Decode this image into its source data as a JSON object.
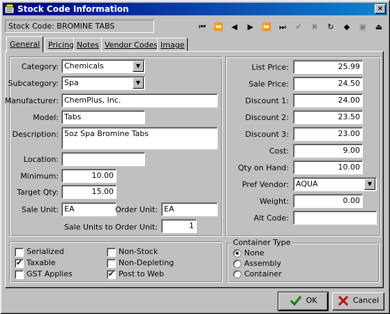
{
  "window": {
    "title": "Stock Code Information",
    "title_icon": "app-icon",
    "close_glyph": "×"
  },
  "header": {
    "stock_code": "Stock Code: BROMINE TABS"
  },
  "nav": {
    "buttons": [
      {
        "name": "first-record",
        "glyph": "⏮",
        "enabled": true
      },
      {
        "name": "prev-page",
        "glyph": "⏪",
        "enabled": true
      },
      {
        "name": "prev-record",
        "glyph": "◀",
        "enabled": true
      },
      {
        "name": "next-record",
        "glyph": "▶",
        "enabled": true
      },
      {
        "name": "next-page",
        "glyph": "⏩",
        "enabled": true
      },
      {
        "name": "last-record",
        "glyph": "⏭",
        "enabled": true
      },
      {
        "name": "confirm",
        "glyph": "✔",
        "enabled": false
      },
      {
        "name": "cancel-edit",
        "glyph": "✖",
        "enabled": false
      },
      {
        "name": "refresh",
        "glyph": "↻",
        "enabled": true
      },
      {
        "name": "tag",
        "glyph": "◆",
        "enabled": true
      },
      {
        "name": "note",
        "glyph": "▣",
        "enabled": false
      },
      {
        "name": "exit",
        "glyph": "⏏",
        "enabled": true
      }
    ]
  },
  "tabs": [
    {
      "label": "General",
      "active": true
    },
    {
      "label": "Pricing"
    },
    {
      "label": "Notes"
    },
    {
      "label": "Vendor Codes"
    },
    {
      "label": "Image"
    }
  ],
  "left": {
    "category": {
      "label": "Category:",
      "value": "Chemicals"
    },
    "subcategory": {
      "label": "Subcategory:",
      "value": "Spa"
    },
    "manufacturer": {
      "label": "Manufacturer:",
      "value": "ChemPlus, Inc."
    },
    "model": {
      "label": "Model:",
      "value": "Tabs"
    },
    "description": {
      "label": "Description:",
      "value": "5oz Spa Bromine Tabs"
    },
    "location": {
      "label": "Location:",
      "value": ""
    },
    "minimum": {
      "label": "Minimum:",
      "value": "10.00"
    },
    "target_qty": {
      "label": "Target Qty:",
      "value": "15.00"
    },
    "sale_unit": {
      "label": "Sale Unit:",
      "value": "EA"
    },
    "order_unit": {
      "label": "Order Unit:",
      "value": "EA"
    },
    "sale_to_order": {
      "label": "Sale Units to Order Unit:",
      "value": "1"
    }
  },
  "right": {
    "list_price": {
      "label": "List Price:",
      "value": "25.99"
    },
    "sale_price": {
      "label": "Sale Price:",
      "value": "24.50"
    },
    "discount1": {
      "label": "Discount 1:",
      "value": "24.00"
    },
    "discount2": {
      "label": "Discount 2:",
      "value": "23.50"
    },
    "discount3": {
      "label": "Discount 3:",
      "value": "23.00"
    },
    "cost": {
      "label": "Cost:",
      "value": "9.00"
    },
    "qty_on_hand": {
      "label": "Qty on Hand:",
      "value": "10.00"
    },
    "pref_vendor": {
      "label": "Pref Vendor:",
      "value": "AQUA"
    },
    "weight": {
      "label": "Weight:",
      "value": "0.00"
    },
    "alt_code": {
      "label": "Alt Code:",
      "value": ""
    }
  },
  "flags": {
    "serialized": {
      "label": "Serialized",
      "checked": false
    },
    "taxable": {
      "label": "Taxable",
      "checked": true
    },
    "gst": {
      "label": "GST Applies",
      "checked": false
    },
    "non_stock": {
      "label": "Non-Stock",
      "checked": false
    },
    "non_depleting": {
      "label": "Non-Depleting",
      "checked": false
    },
    "post_to_web": {
      "label": "Post to Web",
      "checked": true
    }
  },
  "container_type": {
    "title": "Container Type",
    "options": [
      "None",
      "Assembly",
      "Container"
    ],
    "selected": "None"
  },
  "buttons": {
    "ok": "OK",
    "cancel": "Cancel"
  },
  "colors": {
    "title_start": "#000080",
    "title_end": "#1084d0",
    "face": "#c0c0c0",
    "ok_check": "#008000",
    "cancel_x": "#c00000"
  }
}
